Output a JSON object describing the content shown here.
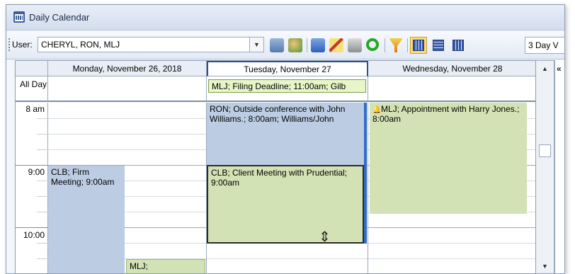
{
  "window": {
    "title": "Daily Calendar"
  },
  "toolbar": {
    "user_label": "User:",
    "user_value": "CHERYL, RON, MLJ",
    "view_select": "3 Day V",
    "icons": [
      "print-icon",
      "people-icon",
      "new-event-icon",
      "edit-icon",
      "copy-icon",
      "refresh-icon",
      "filter-icon",
      "day-view-icon",
      "week-view-icon",
      "month-view-icon"
    ]
  },
  "calendar": {
    "allday_label": "All Day",
    "days": [
      {
        "header": "Monday, November 26, 2018"
      },
      {
        "header": "Tuesday, November 27",
        "allday_event": "MLJ; Filing Deadline; 11:00am; Gilb"
      },
      {
        "header": "Wednesday, November 28"
      }
    ],
    "times": [
      "8 am",
      "9:00",
      "10:00"
    ],
    "events": {
      "mon_firm_meeting": "CLB; Firm Meeting; 9:00am",
      "mon_mlj": "MLJ;",
      "tue_ron": "RON; Outside conference with John Williams.; 8:00am; Williams/John",
      "tue_clb": "CLB; Client Meeting with Prudential; 9:00am",
      "wed_mlj": "MLJ; Appointment with Harry Jones.; 8:00am"
    }
  },
  "colors": {
    "blue_event": "#bccde3",
    "green_event": "#d3e2b4",
    "allday_event": "#e8f5c8"
  }
}
